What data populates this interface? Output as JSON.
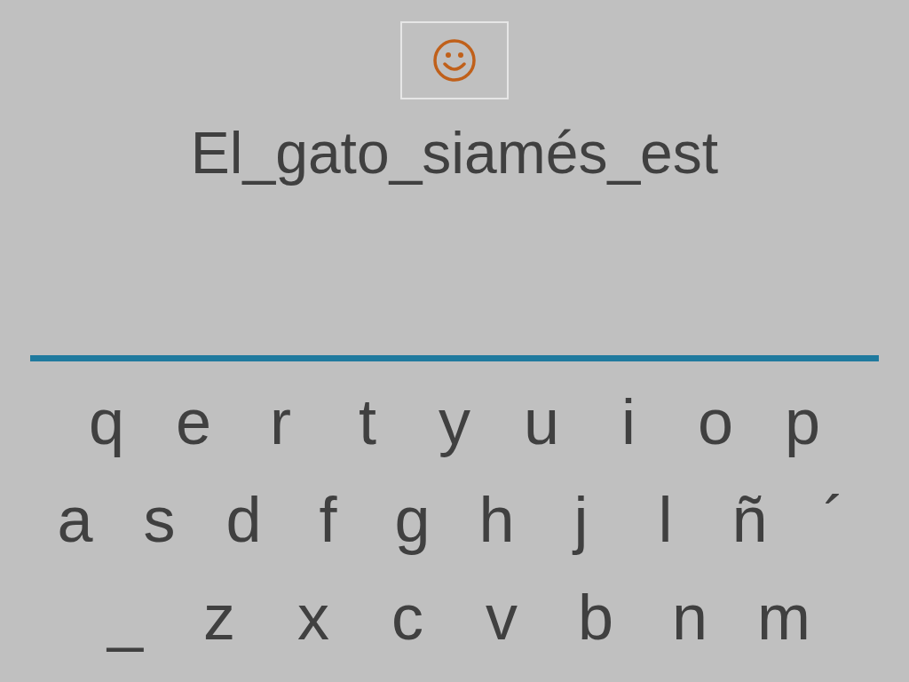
{
  "sentence": "El_gato_siamés_est",
  "keyboard": [
    [
      "q",
      "e",
      "r",
      "t",
      "y",
      "u",
      "i",
      "o",
      "p"
    ],
    [
      "a",
      "s",
      "d",
      "f",
      "g",
      "h",
      "j",
      "l",
      "ñ",
      "´"
    ],
    [
      "_",
      "z",
      "x",
      "c",
      "v",
      "b",
      "n",
      "m"
    ]
  ]
}
